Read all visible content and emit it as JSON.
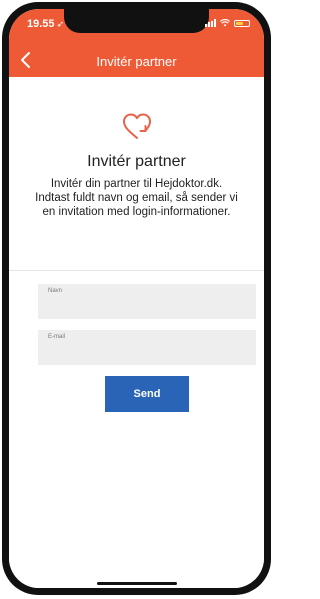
{
  "status_bar": {
    "time": "19.55",
    "location_arrow": "➶",
    "icons": [
      "signal-icon",
      "wifi-icon",
      "battery-icon"
    ]
  },
  "nav": {
    "title": "Invitér partner",
    "back_icon": "chevron-left-icon"
  },
  "colors": {
    "header": "#ee5a35",
    "accent_heart": "#e8634a",
    "button": "#2a64b6",
    "field_bg": "#eeeeee"
  },
  "main": {
    "icon": "heart-arrow-icon",
    "heading": "Invitér partner",
    "description": "Invitér din partner til Hejdoktor.dk. Indtast fuldt navn og email, så sender vi en invitation med login-informationer.",
    "fields": {
      "name_label": "Navn",
      "name_value": "",
      "email_label": "E-mail",
      "email_value": ""
    },
    "send_label": "Send"
  }
}
